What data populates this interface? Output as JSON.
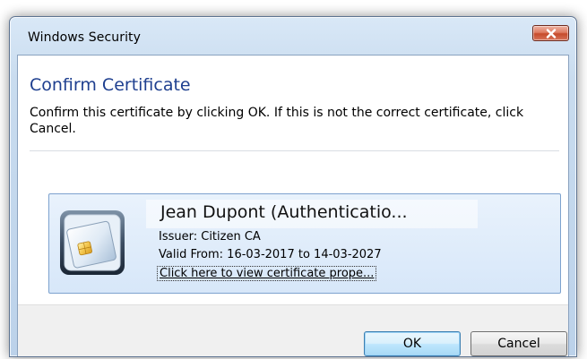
{
  "window": {
    "title": "Windows Security",
    "close_icon": "close-icon"
  },
  "dialog": {
    "heading": "Confirm Certificate",
    "instructions": "Confirm this certificate by clicking OK. If this is not the correct certificate, click Cancel."
  },
  "certificate": {
    "icon": "smart-card-icon",
    "name": "Jean Dupont  (Authenticatio...",
    "issuer": "Issuer: Citizen CA",
    "validity": "Valid From: 16-03-2017 to 14-03-2027",
    "details_link": "Click here to view certificate prope..."
  },
  "buttons": {
    "ok": "OK",
    "cancel": "Cancel"
  },
  "colors": {
    "heading": "#1e3f8f",
    "tile_border": "#7da2ce",
    "close_button": "#c64b2c"
  }
}
